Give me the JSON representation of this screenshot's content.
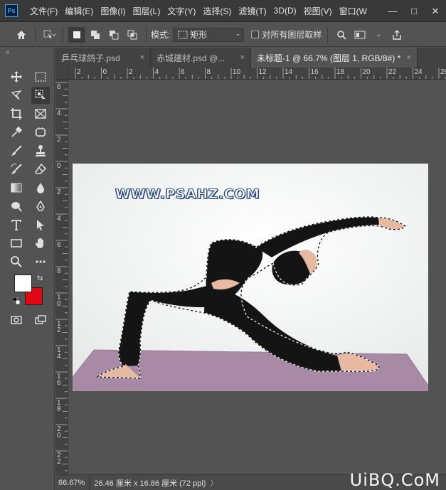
{
  "app": {
    "logo": "Ps",
    "menu": [
      "文件(F)",
      "编辑(E)",
      "图像(I)",
      "图层(L)",
      "文字(Y)",
      "选择(S)",
      "滤镜(T)",
      "3D(D)",
      "视图(V)",
      "窗口(W"
    ],
    "window_controls": [
      "—",
      "□",
      "✕"
    ]
  },
  "options_bar": {
    "mode_label": "模式:",
    "mode_value": "矩形",
    "sample_all_layers_label": "对所有图层取样"
  },
  "tabs": [
    {
      "label": "乒乓球鸽子.psd",
      "close": "×",
      "active": false
    },
    {
      "label": "赤城建材.psd @...",
      "close": "×",
      "active": false
    },
    {
      "label": "未标题-1 @ 66.7% (图层 1, RGB/8#) *",
      "close": "×",
      "active": true
    }
  ],
  "ruler_top_labels": [
    "2",
    "0",
    "2",
    "4",
    "6",
    "8",
    "10",
    "12",
    "14",
    "16",
    "18",
    "20",
    "22",
    "24",
    "26"
  ],
  "ruler_left_labels": [
    "6",
    "4",
    "2",
    "0",
    "2",
    "4",
    "6",
    "8",
    "10",
    "12",
    "14",
    "16",
    "18",
    "20",
    "22"
  ],
  "canvas": {
    "watermark_text": "WWW.PSAHZ.COM"
  },
  "colors": {
    "foreground": "#ffffff",
    "background": "#e30613",
    "accent": "#31a8ff"
  },
  "status": {
    "zoom": "66.67%",
    "doc_size": "26.46 厘米 x 16.86 厘米 (72 ppi)",
    "arrow": "〉"
  },
  "site_mark": "UiBQ.CoM",
  "tools": [
    "move-icon",
    "marquee-icon",
    "lasso-icon",
    "object-select-icon",
    "crop-icon",
    "frame-icon",
    "eyedropper-icon",
    "patch-icon",
    "brush-icon",
    "stamp-icon",
    "history-brush-icon",
    "eraser-icon",
    "gradient-icon",
    "blur-icon",
    "dodge-icon",
    "pen-icon",
    "type-icon",
    "path-select-icon",
    "rectangle-icon",
    "hand-icon",
    "zoom-icon",
    "more-icon",
    "quick-mask-icon",
    "screen-mode-icon"
  ]
}
